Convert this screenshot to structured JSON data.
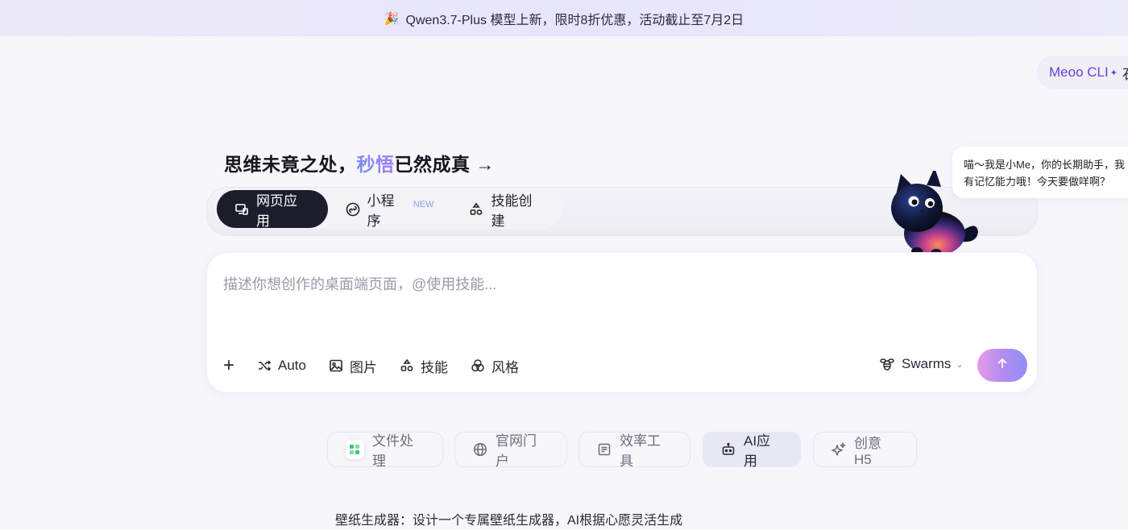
{
  "banner": {
    "emoji": "🎉",
    "text": "Qwen3.7-Plus 模型上新，限时8折优惠，活动截止至7月2日"
  },
  "cli_pill": {
    "label": "Meoo CLI",
    "spark": "✦",
    "trailing": "石"
  },
  "headline": {
    "part1": "思维未竟之处，",
    "accent": "秒悟",
    "part2": "已然成真",
    "arrow": "→"
  },
  "mode_tabs": [
    {
      "label": "网页应用",
      "icon": "monitor-icon",
      "active": true
    },
    {
      "label": "小程序",
      "icon": "mini-program-icon",
      "badge": "NEW",
      "active": false
    },
    {
      "label": "技能创建",
      "icon": "skills-icon",
      "active": false
    }
  ],
  "mascot_bubble": {
    "line1": "喵～我是小Me，你的长期助手，我",
    "line2": "有记忆能力哦！今天要做咩啊？"
  },
  "prompt": {
    "placeholder": "描述你想创作的桌面端页面，@使用技能...",
    "value": ""
  },
  "tools": {
    "add": "+",
    "auto": "Auto",
    "image": "图片",
    "skill": "技能",
    "style": "风格",
    "swarms": "Swarms"
  },
  "categories": [
    {
      "label": "文件处理",
      "icon": "file-grid-icon",
      "active": false
    },
    {
      "label": "官网门户",
      "icon": "globe-icon",
      "active": false
    },
    {
      "label": "效率工具",
      "icon": "notes-icon",
      "active": false
    },
    {
      "label": "AI应用",
      "icon": "robot-icon",
      "active": true
    },
    {
      "label": "创意H5",
      "icon": "sparkle-icon",
      "active": false
    }
  ],
  "description": "壁纸生成器：设计一个专属壁纸生成器，AI根据心愿灵活生成",
  "colors": {
    "accent_purple": "#6a3fd1",
    "dark_tab": "#1b1d2a",
    "send_gradient_start": "#e59be8",
    "send_gradient_end": "#8f8ff5"
  }
}
